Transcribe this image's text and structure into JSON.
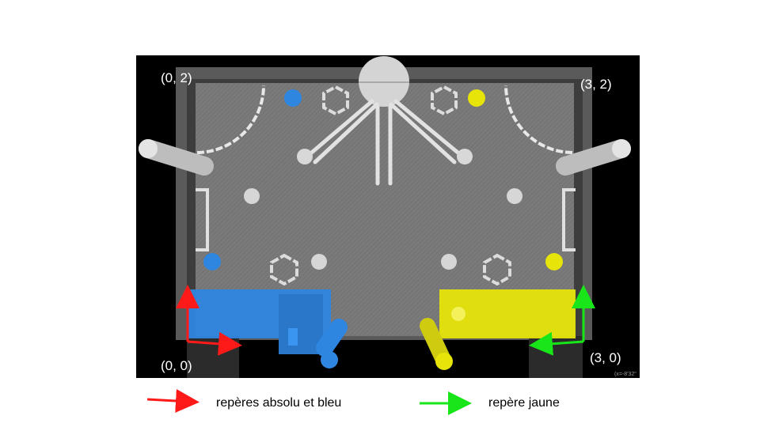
{
  "labels": {
    "top_left": "(0, 2)",
    "top_right": "(3, 2)",
    "bottom_left": "(0, 0)",
    "bottom_right": "(3, 0)",
    "timestamp": "(x=-8'32\""
  },
  "legend": {
    "red_label": "repères absolu et bleu",
    "green_label": "repère jaune"
  },
  "colors": {
    "blue_team": "#2f86e0",
    "yellow_team": "#e7e40a",
    "red_axis": "#ff1a1a",
    "green_axis": "#19e619",
    "field": "#777777",
    "background": "#000000"
  }
}
